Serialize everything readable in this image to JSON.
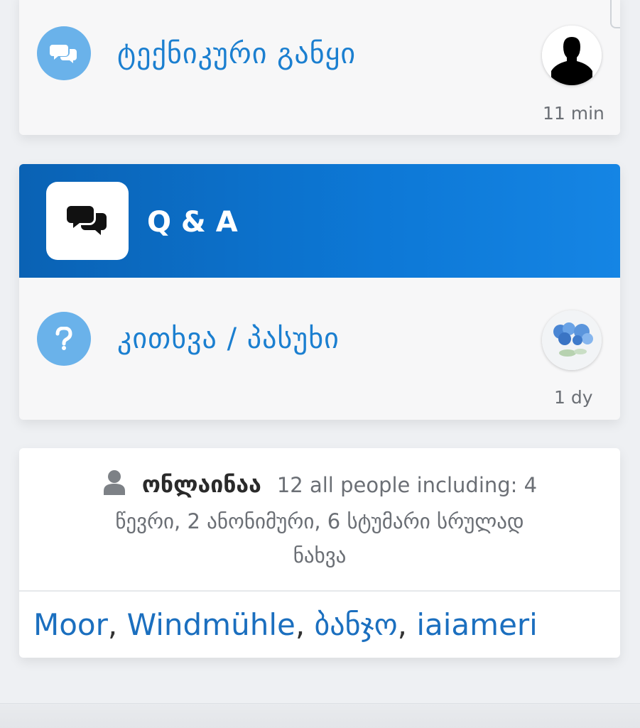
{
  "forum_tech": {
    "title": "ტექნიკური განყი",
    "time": "11 min",
    "icon": "chat-bubbles-icon",
    "avatar": "silhouette-avatar"
  },
  "category_qa": {
    "title": "Q & A",
    "icon": "chat-bubbles-icon"
  },
  "forum_qa": {
    "title": "კითხვა / პასუხი",
    "time": "1 dy",
    "icon": "question-icon",
    "avatar": "blue-flowers-avatar"
  },
  "online": {
    "title": "ონლაინაა",
    "line1_rest": "12 all people including: 4",
    "line2": "წევრი, 2 ანონიმური, 6 სტუმარი სრულად",
    "line3": "ნახვა",
    "users": [
      "Moor",
      "Windmühle",
      "ბანჯო",
      "iaiameri"
    ],
    "separator": ", "
  },
  "colors": {
    "accent": "#1b7fd0",
    "header_gradient_start": "#0a62b4",
    "header_gradient_end": "#1585e4",
    "icon_bg": "#6ab2ea"
  }
}
